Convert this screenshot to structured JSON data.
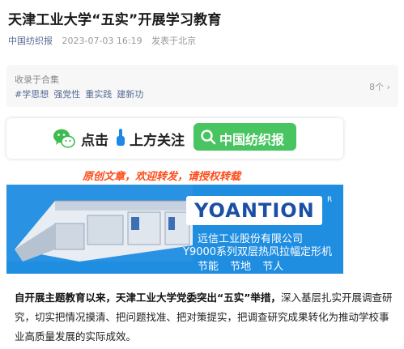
{
  "article": {
    "title": "天津工业大学“五实”开展学习教育",
    "account": "中国纺织报",
    "date": "2023-07-03 16:19",
    "location": "发表于北京"
  },
  "collection": {
    "label": "收录于合集",
    "tags": [
      "#学思想",
      "强党性",
      "重实践",
      "建新功"
    ],
    "count": "8个 ›"
  },
  "follow_banner": {
    "text_click": "点击",
    "text_follow": "上方关注",
    "search_label": "中国纺织报",
    "icons": [
      "wechat-icon",
      "hand-pointer-icon",
      "search-icon"
    ],
    "accent": "#48c460"
  },
  "notice": "原创文章，欢迎转发，请授权转载",
  "ad": {
    "logo": "YOANTION",
    "reg": "R",
    "company": "远信工业股份有限公司",
    "model": "Y9000系列双层热风拉幅定形机",
    "slogan": "节能  节地  节人",
    "bg_color": "#1f8de0"
  },
  "body": {
    "bold_lead": "自开展主题教育以来，天津工业大学党委突出“五实”举措，",
    "rest": "深入基层扎实开展调查研究，切实把情况摸清、把问题找准、把对策提实，把调查研究成果转化为推动学校事业高质量发展的实际成效。"
  }
}
